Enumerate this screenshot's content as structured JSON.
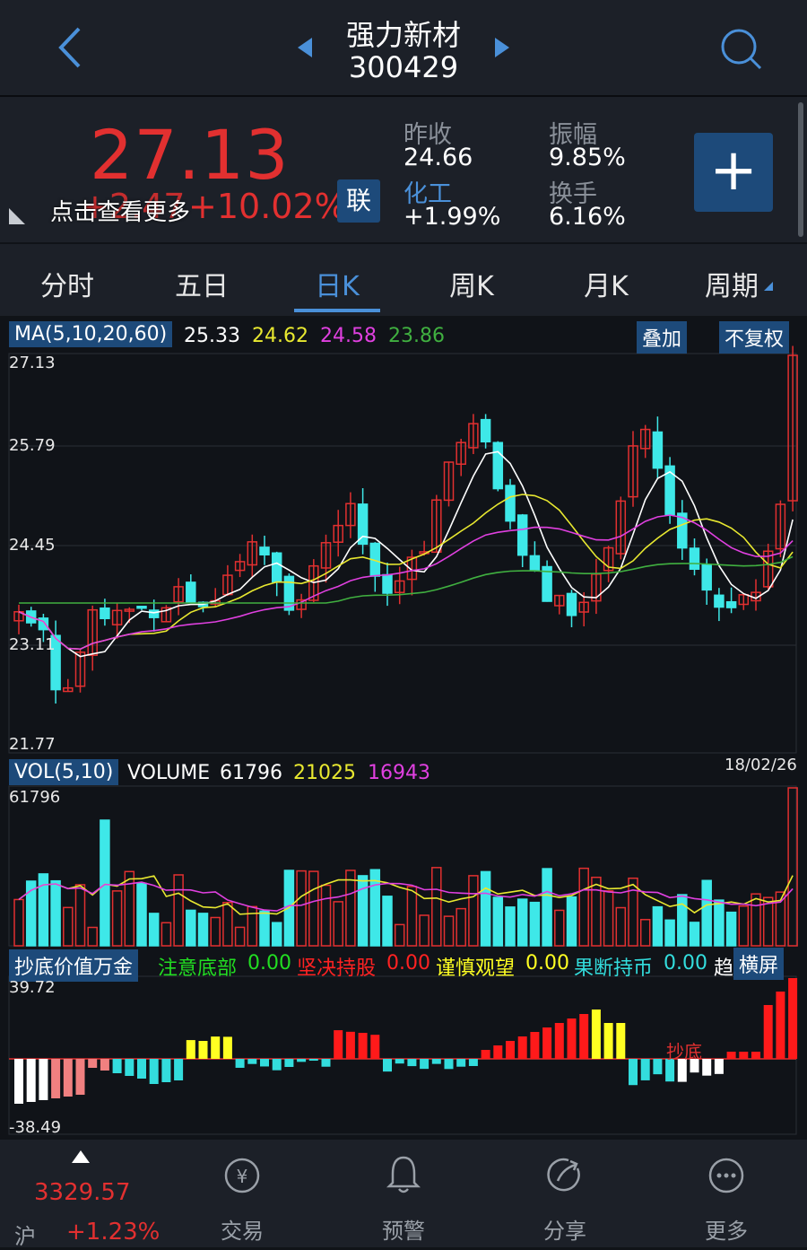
{
  "header": {
    "name": "强力新材",
    "code": "300429"
  },
  "quote": {
    "price": "27.13",
    "change": "+2.47",
    "change_pct": "+10.02%",
    "overlay_text": "点击查看更多",
    "lian": "联",
    "prev_close_label": "昨收",
    "prev_close": "24.66",
    "industry_label": "化工",
    "industry_change": "+1.99%",
    "amplitude_label": "振幅",
    "amplitude": "9.85%",
    "turnover_label": "换手",
    "turnover": "6.16%",
    "add_symbol": "+"
  },
  "tabs": [
    "分时",
    "五日",
    "日K",
    "周K",
    "月K",
    "周期"
  ],
  "main_chart": {
    "ma_label": "MA(5,10,20,60)",
    "ma_values": [
      "25.33",
      "24.62",
      "24.58",
      "23.86"
    ],
    "overlay_btn": "叠加",
    "adjust_btn": "不复权",
    "y_ticks": [
      "27.13",
      "25.79",
      "24.45",
      "23.11",
      "21.77"
    ],
    "date": "18/02/26"
  },
  "volume_chart": {
    "label": "VOL(5,10)",
    "volume_text": "VOLUME",
    "values": [
      "61796",
      "21025",
      "16943"
    ],
    "top_tick": "61796"
  },
  "indicator": {
    "label": "抄底价值万金",
    "items": [
      {
        "name": "注意底部",
        "value": "0.00",
        "color": "#22dd22"
      },
      {
        "name": "坚决持股",
        "value": "0.00",
        "color": "#ff2222"
      },
      {
        "name": "谨慎观望",
        "value": "0.00",
        "color": "#ffff22"
      },
      {
        "name": "果断持币",
        "value": "0.00",
        "color": "#33dddd"
      }
    ],
    "trailing": "趋",
    "landscape_btn": "横屏",
    "top_tick": "39.72",
    "bottom_tick": "-38.49",
    "annotation": "抄底"
  },
  "bottom_nav": {
    "index_value": "3329.57",
    "index_name": "沪",
    "index_change": "+1.23%",
    "items": [
      "交易",
      "预警",
      "分享",
      "更多"
    ]
  },
  "colors": {
    "up": "#e23030",
    "down": "#3ee8e8",
    "accent": "#4a90d9"
  }
}
